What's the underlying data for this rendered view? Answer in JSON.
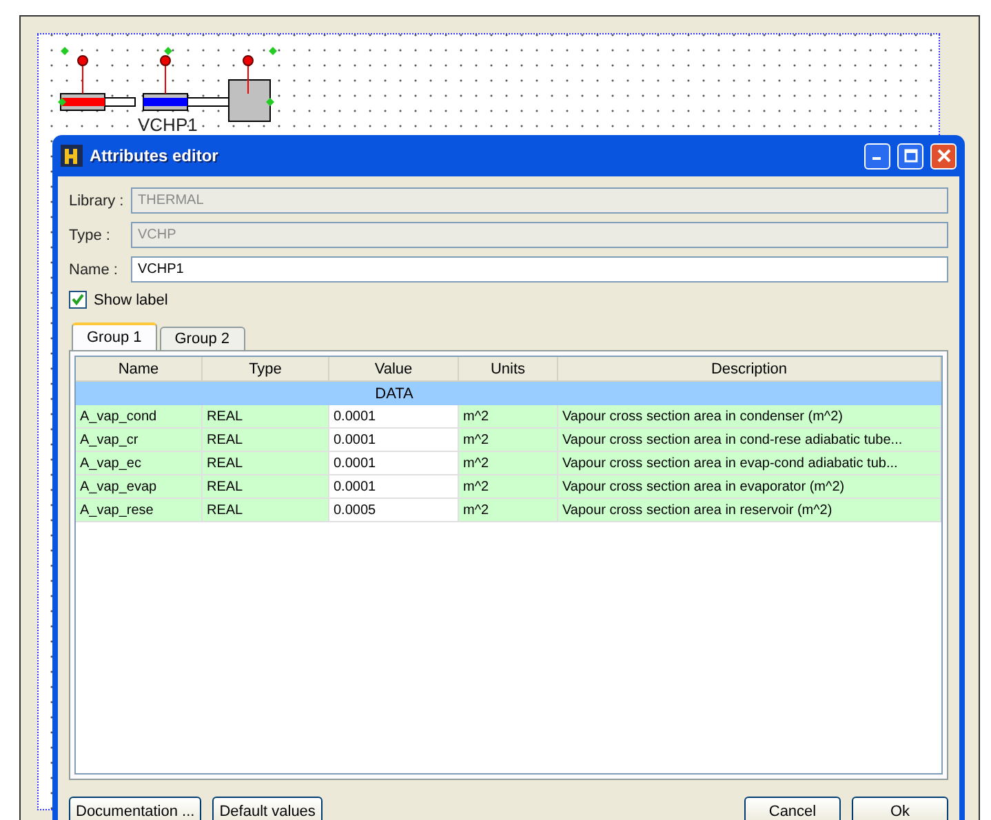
{
  "canvas": {
    "component_label": "VCHP1"
  },
  "dialog": {
    "title": "Attributes editor",
    "fields": [
      {
        "label": "Library :",
        "value": "THERMAL",
        "disabled": true
      },
      {
        "label": "Type :",
        "value": "VCHP",
        "disabled": true
      },
      {
        "label": "Name :",
        "value": "VCHP1",
        "disabled": false
      }
    ],
    "show_label": {
      "label": "Show label",
      "checked": true
    },
    "tabs": [
      {
        "label": "Group 1",
        "selected": true
      },
      {
        "label": "Group 2",
        "selected": false
      }
    ],
    "table": {
      "columns": [
        "Name",
        "Type",
        "Value",
        "Units",
        "Description"
      ],
      "group": "DATA",
      "rows": [
        {
          "name": "A_vap_cond",
          "type": "REAL",
          "value": "0.0001",
          "units": "m^2",
          "description": "Vapour cross section area in condenser (m^2)"
        },
        {
          "name": "A_vap_cr",
          "type": "REAL",
          "value": "0.0001",
          "units": "m^2",
          "description": "Vapour cross section area in cond-rese adiabatic tube..."
        },
        {
          "name": "A_vap_ec",
          "type": "REAL",
          "value": "0.0001",
          "units": "m^2",
          "description": "Vapour cross section area in evap-cond adiabatic tub..."
        },
        {
          "name": "A_vap_evap",
          "type": "REAL",
          "value": "0.0001",
          "units": "m^2",
          "description": "Vapour cross section area in evaporator (m^2)"
        },
        {
          "name": "A_vap_rese",
          "type": "REAL",
          "value": "0.0005",
          "units": "m^2",
          "description": "Vapour cross section area in reservoir (m^2)"
        }
      ]
    },
    "buttons_left": [
      "Documentation ...",
      "Default values"
    ],
    "buttons_right": [
      "Cancel",
      "Ok"
    ]
  }
}
